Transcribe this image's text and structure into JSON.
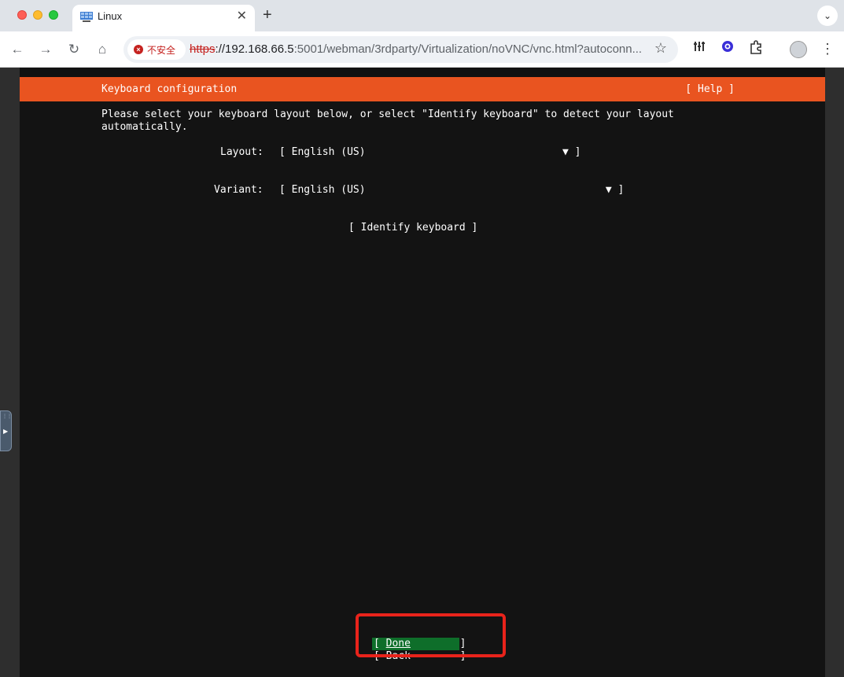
{
  "browser": {
    "tab_title": "Linux",
    "tab_close": "✕",
    "new_tab": "+",
    "tab_search": "⌄",
    "nav": {
      "back": "←",
      "forward": "→",
      "reload": "↻",
      "home": "⌂"
    },
    "security_label": "不安全",
    "url_scheme": "https",
    "url_host": "://192.168.66.5",
    "url_rest": ":5001/webman/3rdparty/Virtualization/noVNC/vnc.html?autoconn...",
    "bookmark": "☆",
    "menu": "⋮"
  },
  "installer": {
    "header_title": "Keyboard configuration",
    "header_help": "[ Help ]",
    "instruction_line1": "Please select your keyboard layout below, or select \"Identify keyboard\" to detect your layout",
    "instruction_line2": "automatically.",
    "layout_label": "Layout:",
    "layout_value": "[ English (US)                                ▼ ]",
    "variant_label": "Variant:",
    "variant_value": "[ English (US)                                       ▼ ]",
    "identify_button": "[ Identify keyboard ]",
    "done_open": "[ ",
    "done_label": "Done",
    "done_close": "        ]",
    "back_button": "[ Back        ]"
  },
  "colors": {
    "header": "#e95420",
    "done_background": "#0e6e2a",
    "annotation": "#e8231b"
  }
}
